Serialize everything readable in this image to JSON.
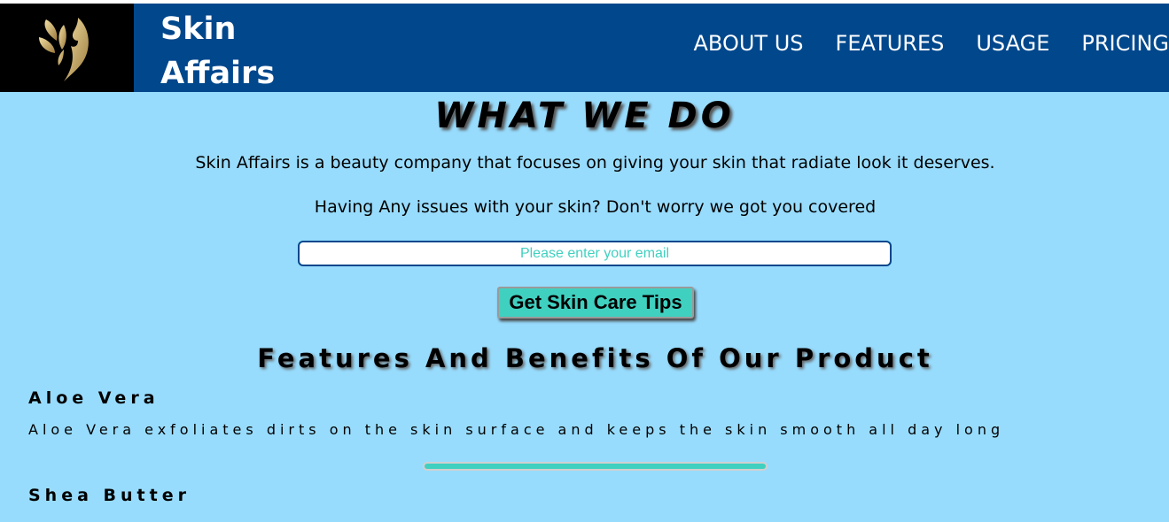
{
  "header": {
    "brand": "Skin Affairs",
    "nav": [
      "ABOUT US",
      "FEATURES",
      "USAGE",
      "PRICING"
    ]
  },
  "hero": {
    "title": "WHAT WE DO",
    "para1": "Skin Affairs is a beauty company that focuses on giving your skin that radiate look it deserves.",
    "para2": "Having Any issues with your skin? Don't worry we got you covered",
    "email_placeholder": "Please enter your email",
    "button": "Get Skin Care Tips"
  },
  "features": {
    "title": "Features And Benefits Of Our Product",
    "items": [
      {
        "name": "Aloe Vera",
        "desc": "Aloe Vera exfoliates dirts on the skin surface and keeps the skin smooth all day long"
      },
      {
        "name": "Shea Butter",
        "desc": ""
      }
    ]
  },
  "colors": {
    "background": "#98dcfd",
    "header": "#00478c",
    "accent": "#40d0c0",
    "logo_gold": "#c9a96a"
  },
  "icons": {
    "logo": "leaf-face-icon"
  }
}
